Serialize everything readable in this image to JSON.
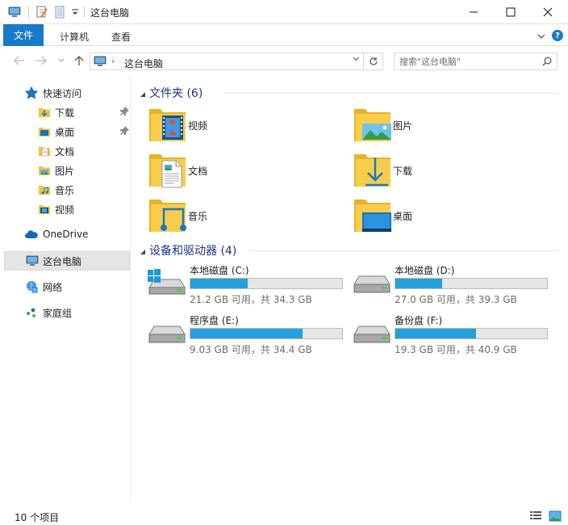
{
  "window": {
    "title": "这台电脑",
    "icons": {
      "app": "computer-icon",
      "properties": "properties-icon",
      "new_folder": "new-folder-icon",
      "customize": "chevron-down-icon"
    }
  },
  "ribbon": {
    "tabs": [
      {
        "label": "文件",
        "active": true
      },
      {
        "label": "计算机"
      },
      {
        "label": "查看"
      }
    ],
    "help_label": "?"
  },
  "address_bar": {
    "location": "这台电脑",
    "location_icon": "computer-icon"
  },
  "search": {
    "placeholder": "搜索\"这台电脑\""
  },
  "nav_pane": {
    "quick_access": {
      "label": "快速访问",
      "items": [
        {
          "label": "下载",
          "icon": "download-folder-icon",
          "pinned": true
        },
        {
          "label": "桌面",
          "icon": "desktop-folder-icon",
          "pinned": true
        },
        {
          "label": "文档",
          "icon": "documents-folder-icon"
        },
        {
          "label": "图片",
          "icon": "pictures-folder-icon"
        },
        {
          "label": "音乐",
          "icon": "music-folder-icon"
        },
        {
          "label": "视频",
          "icon": "videos-folder-icon"
        }
      ]
    },
    "onedrive": "OneDrive",
    "this_pc": "这台电脑",
    "network": "网络",
    "homegroup": "家庭组"
  },
  "folders": {
    "title": "文件夹 (6)",
    "items": [
      {
        "label": "视频",
        "icon": "videos-folder-icon"
      },
      {
        "label": "图片",
        "icon": "pictures-folder-icon"
      },
      {
        "label": "文档",
        "icon": "documents-folder-icon"
      },
      {
        "label": "下载",
        "icon": "download-folder-icon"
      },
      {
        "label": "音乐",
        "icon": "music-folder-icon"
      },
      {
        "label": "桌面",
        "icon": "desktop-folder-icon"
      }
    ]
  },
  "drives": {
    "title": "设备和驱动器 (4)",
    "items": [
      {
        "name": "本地磁盘 (C:)",
        "free": "21.2 GB 可用，共 34.3 GB",
        "used_fraction": 0.38,
        "system": true
      },
      {
        "name": "本地磁盘 (D:)",
        "free": "27.0 GB 可用，共 39.3 GB",
        "used_fraction": 0.31
      },
      {
        "name": "程序盘 (E:)",
        "free": "9.03 GB 可用，共 34.4 GB",
        "used_fraction": 0.74
      },
      {
        "name": "备份盘 (F:)",
        "free": "19.3 GB 可用，共 40.9 GB",
        "used_fraction": 0.53
      }
    ]
  },
  "status": {
    "item_count": "10 个项目",
    "view_icons": [
      "details-view-icon",
      "large-icons-view-icon"
    ]
  },
  "colors": {
    "accent": "#1979ca",
    "drive_bar": "#26a0da",
    "group_title": "#1e3287"
  }
}
